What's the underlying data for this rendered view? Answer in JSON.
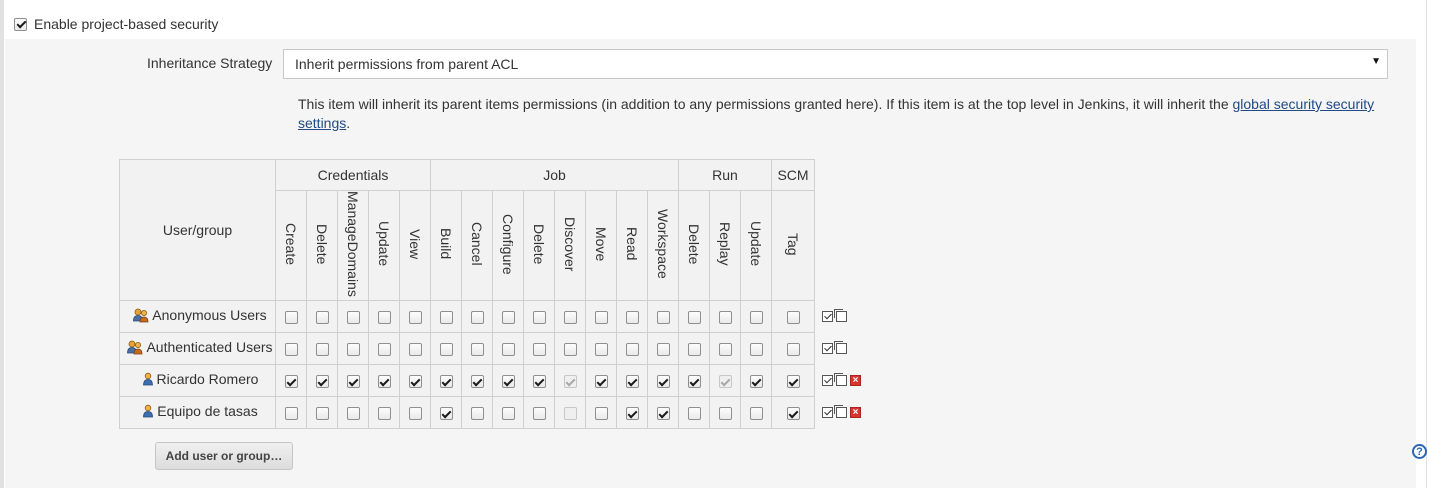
{
  "enable_security": {
    "label": "Enable project-based security",
    "checked": true
  },
  "inheritance": {
    "label": "Inheritance Strategy",
    "selected": "Inherit permissions from parent ACL",
    "description_prefix": "This item will inherit its parent items permissions (in addition to any permissions granted here). If this item is at the top level in Jenkins, it will inherit the ",
    "description_link": "global security security settings",
    "description_suffix": "."
  },
  "matrix": {
    "user_group_header": "User/group",
    "groups": [
      {
        "name": "Credentials",
        "span": 5
      },
      {
        "name": "Job",
        "span": 8
      },
      {
        "name": "Run",
        "span": 3
      },
      {
        "name": "SCM",
        "span": 1
      }
    ],
    "permissions": [
      "Create",
      "Delete",
      "ManageDomains",
      "Update",
      "View",
      "Build",
      "Cancel",
      "Configure",
      "Delete",
      "Discover",
      "Move",
      "Read",
      "Workspace",
      "Delete",
      "Replay",
      "Update",
      "Tag"
    ],
    "rows": [
      {
        "name": "Anonymous Users",
        "icon": "group-icon",
        "removable": false,
        "checks": [
          0,
          0,
          0,
          0,
          0,
          0,
          0,
          0,
          0,
          0,
          0,
          0,
          0,
          0,
          0,
          0,
          0
        ]
      },
      {
        "name": "Authenticated Users",
        "icon": "group-icon",
        "removable": false,
        "checks": [
          0,
          0,
          0,
          0,
          0,
          0,
          0,
          0,
          0,
          0,
          0,
          0,
          0,
          0,
          0,
          0,
          0
        ]
      },
      {
        "name": "Ricardo Romero",
        "icon": "user-icon",
        "removable": true,
        "checks": [
          1,
          1,
          1,
          1,
          1,
          1,
          1,
          1,
          1,
          "dis-on",
          1,
          1,
          1,
          1,
          "dis-on",
          1,
          1
        ]
      },
      {
        "name": "Equipo de tasas",
        "icon": "user-icon",
        "removable": true,
        "checks": [
          0,
          0,
          0,
          0,
          0,
          1,
          0,
          0,
          0,
          "dis-off",
          0,
          1,
          1,
          0,
          0,
          0,
          1
        ]
      }
    ]
  },
  "add_button": "Add user or group…",
  "help": "?"
}
